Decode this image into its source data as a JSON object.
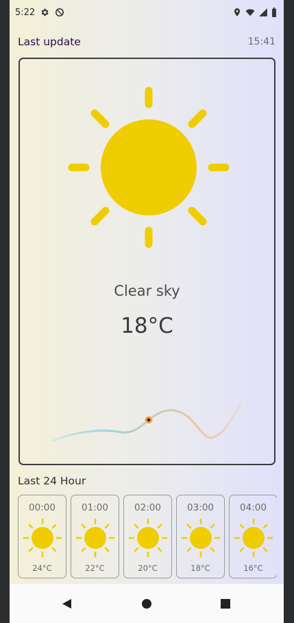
{
  "status": {
    "time": "5:22",
    "left_icons": [
      "settings-icon",
      "do-not-disturb-icon"
    ],
    "right_icons": [
      "location-icon",
      "wifi-icon",
      "signal-icon",
      "battery-icon"
    ]
  },
  "header": {
    "last_update_label": "Last update",
    "last_update_time": "15:41"
  },
  "current": {
    "icon": "sun-icon",
    "condition": "Clear sky",
    "temperature": "18°C"
  },
  "colors": {
    "sun": "#efcd00",
    "title": "#2c0a4a",
    "curve_cold": "#8fd4e8",
    "curve_warm": "#f0c89a",
    "marker": "#f39a3a"
  },
  "hourly_section": {
    "title": "Last 24 Hour",
    "items": [
      {
        "time": "00:00",
        "icon": "sun-icon",
        "temp": "24°C"
      },
      {
        "time": "01:00",
        "icon": "sun-icon",
        "temp": "22°C"
      },
      {
        "time": "02:00",
        "icon": "sun-icon",
        "temp": "20°C"
      },
      {
        "time": "03:00",
        "icon": "sun-icon",
        "temp": "18°C"
      },
      {
        "time": "04:00",
        "icon": "sun-icon",
        "temp": "16°C"
      }
    ]
  },
  "navigation": [
    "back-icon",
    "home-icon",
    "recents-icon"
  ]
}
